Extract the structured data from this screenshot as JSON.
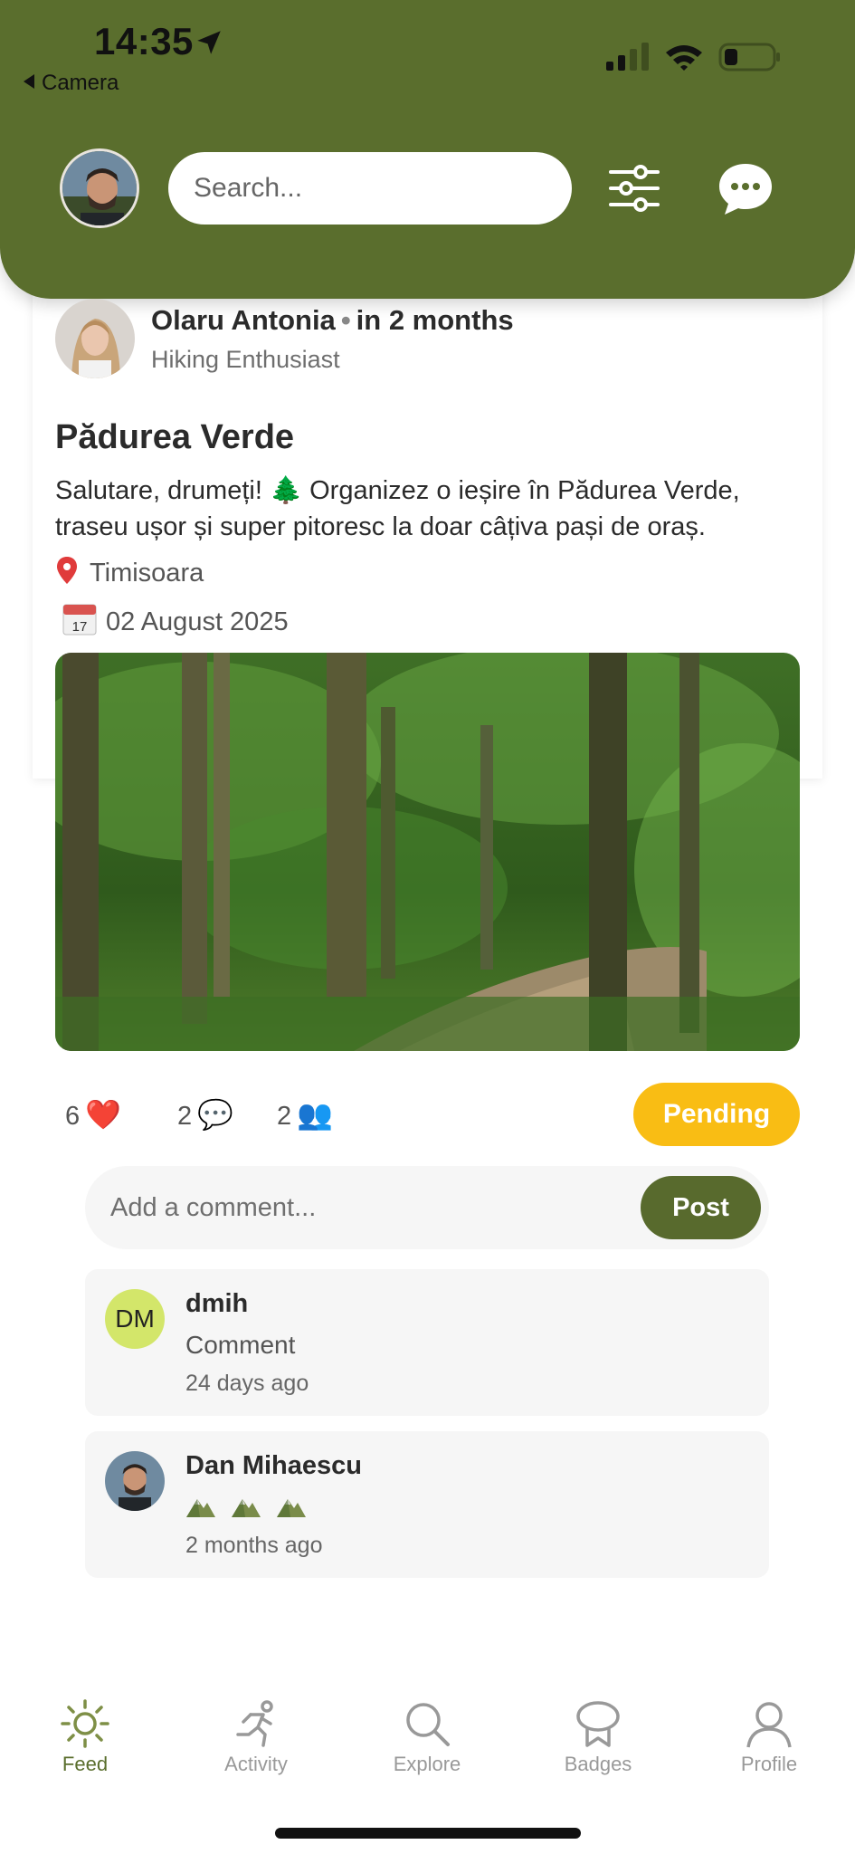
{
  "status_bar": {
    "time": "14:35",
    "back_label": "Camera"
  },
  "header": {
    "search_placeholder": "Search..."
  },
  "post": {
    "author_name": "Olaru Antonia",
    "separator": "•",
    "relative_time": "in 2 months",
    "author_role": "Hiking Enthusiast",
    "title": "Pădurea Verde",
    "body": "Salutare, drumeți! 🌲 Organizez o ieșire în Pădurea Verde, traseu ușor și super pitoresc la doar câțiva pași de oraș.",
    "location": "Timisoara",
    "date": "02 August 2025",
    "likes": "6",
    "likes_icon": "❤️",
    "comments": "2",
    "comments_icon": "💬",
    "participants": "2",
    "participants_icon": "👥",
    "status": "Pending"
  },
  "comment_form": {
    "placeholder": "Add a comment...",
    "submit_label": "Post"
  },
  "comments": [
    {
      "initials": "DM",
      "author": "dmih",
      "text": "Comment",
      "time": "24 days ago"
    },
    {
      "author": "Dan Mihaescu",
      "text_icons": "mountain-emoji x3",
      "time": "2 months ago"
    }
  ],
  "nav": {
    "items": [
      {
        "label": "Feed",
        "icon": "sun-icon",
        "active": true
      },
      {
        "label": "Activity",
        "icon": "running-person-icon",
        "active": false
      },
      {
        "label": "Explore",
        "icon": "search-icon",
        "active": false
      },
      {
        "label": "Badges",
        "icon": "badge-icon",
        "active": false
      },
      {
        "label": "Profile",
        "icon": "person-icon",
        "active": false
      }
    ]
  },
  "colors": {
    "header_green": "#5a6e2d",
    "pending_yellow": "#f9bd14",
    "post_button_green": "#586a2d",
    "initials_bg": "#d3e66a"
  }
}
